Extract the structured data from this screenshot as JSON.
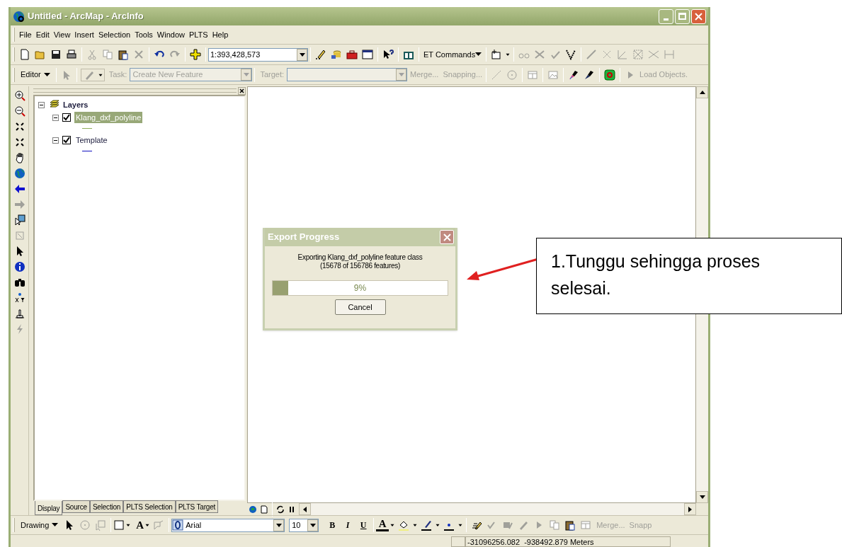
{
  "window": {
    "title": "Untitled - ArcMap - ArcInfo"
  },
  "menu": [
    "File",
    "Edit",
    "View",
    "Insert",
    "Selection",
    "Tools",
    "Window",
    "PLTS",
    "Help"
  ],
  "standard_toolbar": {
    "scale": "1:393,428,573",
    "commands": "ET Commands"
  },
  "editor_toolbar": {
    "editor": "Editor",
    "task_label": "Task:",
    "task": "Create New Feature",
    "target_label": "Target:",
    "merge": "Merge...",
    "snapping": "Snapping...",
    "load_objects": "Load Objects."
  },
  "table_of_contents": {
    "root": "Layers",
    "root_expanded": true,
    "layers": [
      {
        "name": "Klang_dxf_polyline",
        "checked": true,
        "expanded": true,
        "selected": true,
        "color": "#8fae5a"
      },
      {
        "name": "Template",
        "checked": true,
        "expanded": true,
        "selected": false,
        "color": "#1010c0"
      }
    ],
    "tabs": [
      {
        "label": "Display",
        "selected": true
      },
      {
        "label": "Source",
        "selected": false
      },
      {
        "label": "Selection",
        "selected": false
      },
      {
        "label": "PLTS Selection",
        "selected": false
      },
      {
        "label": "PLTS Target",
        "selected": false
      }
    ]
  },
  "dialog": {
    "title": "Export Progress",
    "message": "Exporting Klang_dxf_polyline feature class",
    "count": "(15678 of 156786 features)",
    "progress": {
      "level": 0.09,
      "reading": "9%"
    },
    "button": "Cancel"
  },
  "drawing_toolbar": {
    "drawing": "Drawing",
    "new_text": "A",
    "font": "Arial",
    "size": "10",
    "bold": "B",
    "italic": "I",
    "underline": "U",
    "font_color": "A",
    "merge": "Merge...",
    "snapping": "Snapp"
  },
  "status_bar": {
    "coordinates": "-31096256.082  -938492.879 Meters"
  },
  "callout": {
    "text": "1.Tunggu sehingga proses selesai."
  }
}
